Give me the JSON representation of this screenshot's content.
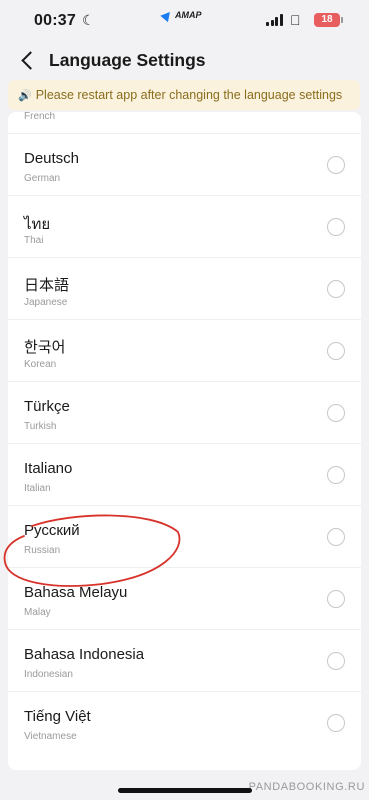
{
  "status": {
    "time": "00:37",
    "carrier_app": "AMAP",
    "battery": "18"
  },
  "nav": {
    "title": "Language Settings"
  },
  "notice": {
    "text": "Please restart app after changing the language settings"
  },
  "languages": [
    {
      "name": "",
      "sub": "French"
    },
    {
      "name": "Deutsch",
      "sub": "German"
    },
    {
      "name": "ไทย",
      "sub": "Thai"
    },
    {
      "name": "日本語",
      "sub": "Japanese"
    },
    {
      "name": "한국어",
      "sub": "Korean"
    },
    {
      "name": "Türkçe",
      "sub": "Turkish"
    },
    {
      "name": "Italiano",
      "sub": "Italian"
    },
    {
      "name": "Русский",
      "sub": "Russian"
    },
    {
      "name": "Bahasa Melayu",
      "sub": "Malay"
    },
    {
      "name": "Bahasa Indonesia",
      "sub": "Indonesian"
    },
    {
      "name": "Tiếng Việt",
      "sub": "Vietnamese"
    }
  ],
  "watermark": "PANDABOOKING.RU",
  "colors": {
    "notice_bg": "#fbf2dd",
    "notice_text": "#8a6d1e",
    "annotation": "#d8332b",
    "battery": "#e85d5d"
  }
}
